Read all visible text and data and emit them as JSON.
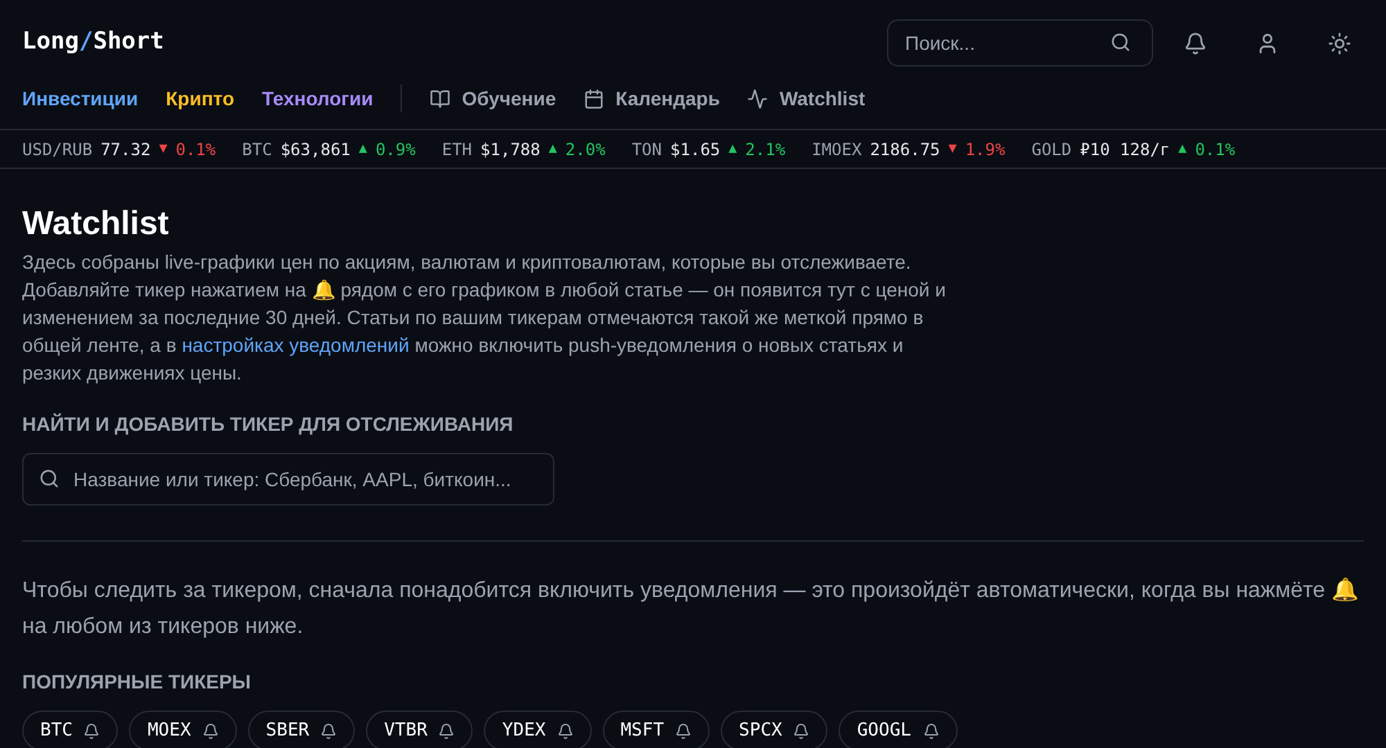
{
  "logo": {
    "left": "Long",
    "slash": "/",
    "right": "Short"
  },
  "search": {
    "placeholder": "Поиск..."
  },
  "nav": {
    "sections": [
      {
        "label": "Инвестиции",
        "color": "#60a5fa"
      },
      {
        "label": "Крипто",
        "color": "#fbbf24"
      },
      {
        "label": "Технологии",
        "color": "#a78bfa"
      }
    ],
    "links": [
      {
        "label": "Обучение",
        "kind": "book"
      },
      {
        "label": "Календарь",
        "kind": "calendar"
      },
      {
        "label": "Watchlist",
        "kind": "pulse"
      }
    ]
  },
  "ticker_bar": [
    {
      "symbol": "USD/RUB",
      "price": "77.32",
      "kind": "down",
      "arrow": "▼",
      "change": "0.1%"
    },
    {
      "symbol": "BTC",
      "price": "$63,861",
      "kind": "up",
      "arrow": "▲",
      "change": "0.9%"
    },
    {
      "symbol": "ETH",
      "price": "$1,788",
      "kind": "up",
      "arrow": "▲",
      "change": "2.0%"
    },
    {
      "symbol": "TON",
      "price": "$1.65",
      "kind": "up",
      "arrow": "▲",
      "change": "2.1%"
    },
    {
      "symbol": "IMOEX",
      "price": "2186.75",
      "kind": "down",
      "arrow": "▼",
      "change": "1.9%"
    },
    {
      "symbol": "GOLD",
      "price": "₽10 128/г",
      "kind": "up",
      "arrow": "▲",
      "change": "0.1%"
    }
  ],
  "page": {
    "title": "Watchlist",
    "intro": {
      "before": "Здесь собраны live-графики цен по акциям, валютам и криптовалютам, которые вы отслеживаете. Добавляйте тикер нажатием на 🔔 рядом с его графиком в любой статье — он появится тут с ценой и изменением за последние 30 дней. Статьи по вашим тикерам отмечаются такой же меткой прямо в общей ленте, а в",
      "link": "настройках уведомлений",
      "after": "можно включить push-уведомления о новых статьях и резких движениях цены."
    },
    "find_label": "НАЙТИ И ДОБАВИТЬ ТИКЕР ДЛЯ ОТСЛЕЖИВАНИЯ",
    "find_placeholder": "Название или тикер: Сбербанк, AAPL, биткоин...",
    "notice": "Чтобы следить за тикером, сначала понадобится включить уведомления — это произойдёт автоматически, когда вы нажмёте 🔔 на любом из тикеров ниже.",
    "popular_label": "ПОПУЛЯРНЫЕ ТИКЕРЫ",
    "popular": [
      "BTC",
      "MOEX",
      "SBER",
      "VTBR",
      "YDEX",
      "MSFT",
      "SPCX",
      "GOOGL"
    ]
  }
}
